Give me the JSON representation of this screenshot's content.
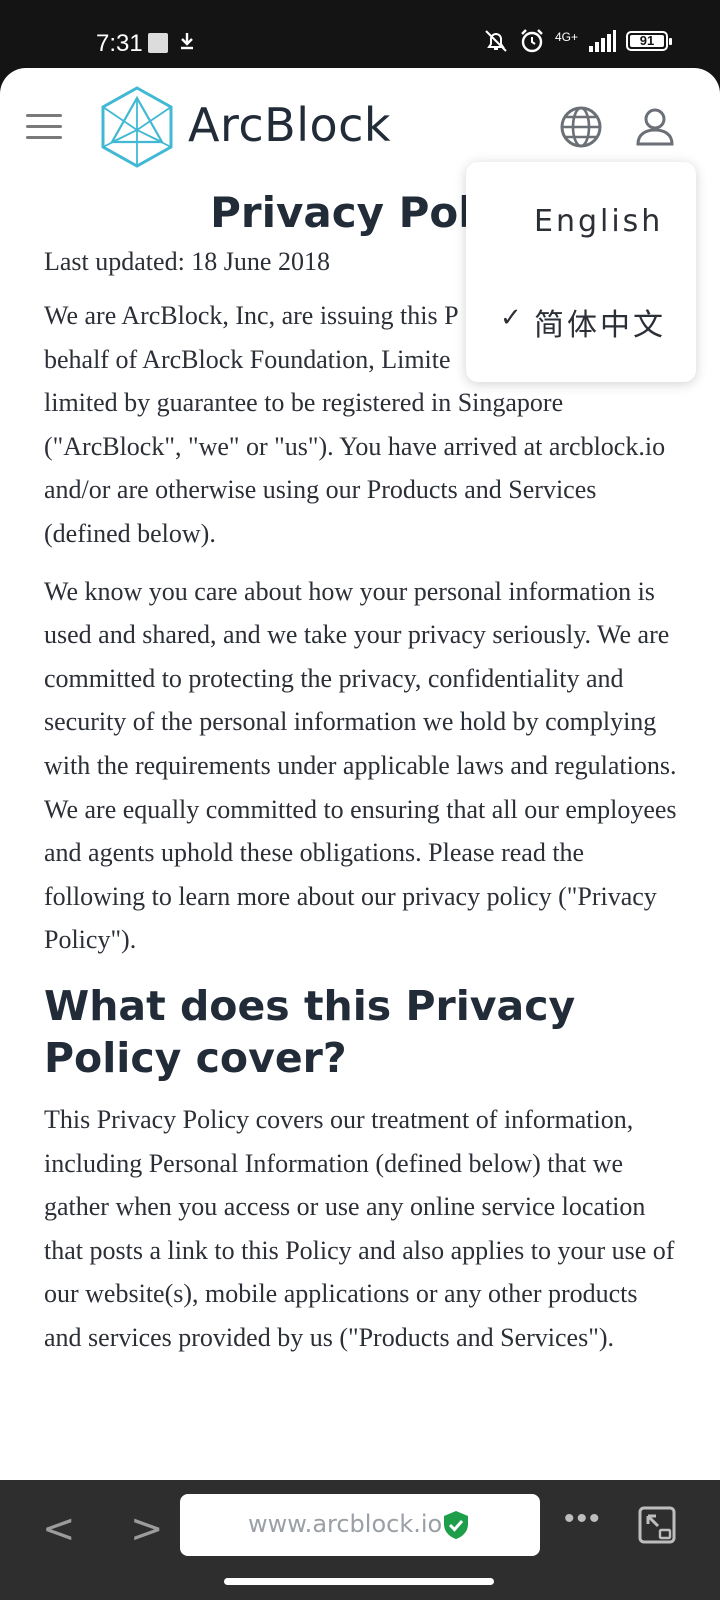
{
  "status_bar": {
    "time": "7:31",
    "network": "4G+",
    "battery": "91"
  },
  "header": {
    "brand": "ArcBlock"
  },
  "page": {
    "title": "Privacy Polic",
    "last_updated": "Last updated: 18 June 2018",
    "para1": "We are ArcBlock, Inc, are issuing this P... behalf of ArcBlock Foundation, Limite... limited by guarantee to be registered in Singapore (\"ArcBlock\", \"we\" or \"us\"). You have arrived at arcblock.io and/or are otherwise using our Products and Services (defined below).",
    "para1_lines": [
      "We are ArcBlock, Inc, are issuing this P",
      "behalf of ArcBlock Foundation, Limite",
      "limited by guarantee to be registered in Singapore",
      "(\"ArcBlock\", \"we\" or \"us\"). You have arrived at arcblock.io",
      "and/or are otherwise using our Products and Services",
      "(defined below)."
    ],
    "para2": "We know you care about how your personal information is used and shared, and we take your privacy seriously. We are committed to protecting the privacy, confidentiality and security of the personal information we hold by complying with the requirements under applicable laws and regulations. We are equally committed to ensuring that all our employees and agents uphold these obligations. Please read the following to learn more about our privacy policy (\"Privacy Policy\").",
    "heading2": "What does this Privacy Policy cover?",
    "para3": "This Privacy Policy covers our treatment of information, including Personal Information (defined below) that we gather when you access or use any online service location that posts a link to this Policy and also applies to your use of our website(s), mobile applications or any other products and services provided by us (\"Products and Services\")."
  },
  "language_menu": {
    "items": [
      {
        "label": "English",
        "selected": false
      },
      {
        "label": "简体中文",
        "selected": true
      }
    ]
  },
  "browser_bar": {
    "url": "www.arcblock.io",
    "back": "<",
    "forward": ">",
    "more": "•••"
  }
}
